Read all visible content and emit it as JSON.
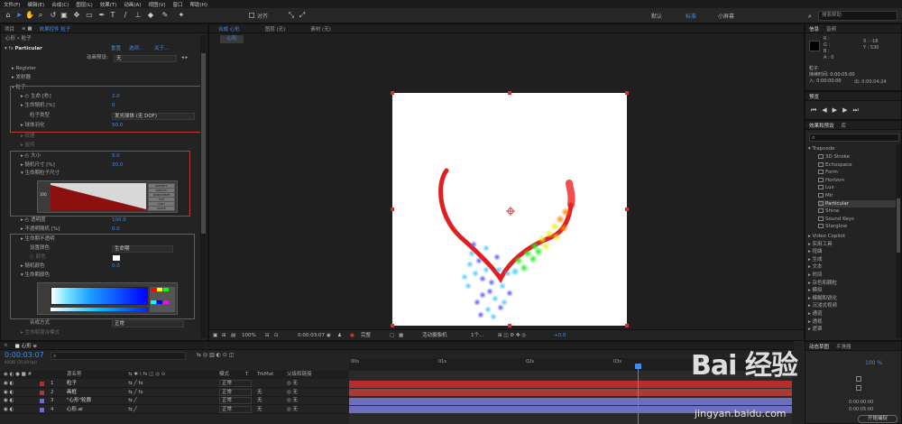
{
  "menu": [
    "文件(F)",
    "编辑(E)",
    "合成(C)",
    "图层(L)",
    "效果(T)",
    "动画(A)",
    "视图(V)",
    "窗口",
    "帮助(H)"
  ],
  "toolbar": {
    "align_label": "对齐",
    "workspaces": [
      "默认",
      "标准",
      "小屏幕"
    ],
    "active_workspace": "标准",
    "search_placeholder": "搜索帮助"
  },
  "project": {
    "tab_project": "项目",
    "tab_effect_controls": "效果控件 粒子",
    "breadcrumb": "心形 • 粒子"
  },
  "effect": {
    "name": "Particular",
    "links": [
      "重置",
      "选项...",
      "关于..."
    ],
    "preset_label": "动画预设:",
    "preset_value": "无",
    "rows": [
      "Register",
      "发射器"
    ],
    "particle_section": "粒子",
    "life": "生命 [秒]",
    "life_val": "2.0",
    "life_rand": "生命随机 [%]",
    "life_rand_val": "0",
    "ptype": "粒子类型",
    "ptype_val": "发光球体 (无 DOF)",
    "sphere": "球体羽化",
    "sphere_val": "50.0",
    "texture": "纹理",
    "rotation": "旋转",
    "size": "大小",
    "size_val": "5.0",
    "size_rand": "随机尺寸 [%]",
    "size_rand_val": "30.0",
    "size_life": "生命期粒子尺寸",
    "graph_label": "100",
    "graph_btns": [
      "PRESETS",
      "SMOOTH",
      "RANDOMIZE",
      "FLIP",
      "COPY",
      "PASTE"
    ],
    "opacity": "透明度",
    "opacity_val": "100.0",
    "opacity_rand": "不透明随机 [%]",
    "opacity_rand_val": "0.0",
    "op_life": "生命期不透明",
    "color_set": "设置颜色",
    "color_set_val": "生命期",
    "color": "颜色",
    "color_rand": "随机颜色",
    "color_rand_val": "0.0",
    "color_life": "生命期颜色",
    "grad_labels": [
      "PRESETS",
      "RANDOMIZE"
    ],
    "blend": "合成方式",
    "blend_val": "正常",
    "trans": "生命期混合模式"
  },
  "viewer": {
    "tabs": [
      "合成 心形",
      "图层 (无)",
      "素材 (无)"
    ],
    "active_tab": "心形",
    "zoom": "100%",
    "timecode": "0:00:03:07",
    "quality": "完整",
    "camera": "活动摄像机",
    "views": "1个...",
    "exposure": "+0.0"
  },
  "info": {
    "tab_info": "信息",
    "tab_audio": "音频",
    "r": "R :",
    "g": "G :",
    "b": "B :",
    "a": "A : 0",
    "x": "X : -18",
    "y": "Y : 530",
    "layer": "粒子",
    "duration": "持续时间: 0:00:05:00",
    "in": "入: 0:00:00:00",
    "out": "出: 0:00:04:24"
  },
  "preview": {
    "tab": "预览"
  },
  "effects_presets": {
    "tab": "效果和预设",
    "tab2": "库",
    "search_placeholder": "",
    "folder": "Trapcode",
    "items": [
      "3D Stroke",
      "Echospace",
      "Form",
      "Horizon",
      "Lux",
      "Mir",
      "Particular",
      "Shine",
      "Sound Keys",
      "Starglow"
    ],
    "selected": "Particular",
    "categories": [
      "Video Copilot",
      "实用工具",
      "扭曲",
      "生成",
      "文本",
      "时间",
      "杂色和颗粒",
      "模拟",
      "模糊和锐化",
      "沉浸式视频",
      "通道",
      "透视",
      "遮罩"
    ]
  },
  "timeline": {
    "tab": "心形",
    "timecode": "0:00:03:07",
    "frames": "00082 (25.00 fps)",
    "col_headers": [
      "源名称",
      "模式",
      "T",
      "TrkMat",
      "父级和链接"
    ],
    "ruler": [
      "00s",
      "01s",
      "02s",
      "03s",
      "04s"
    ],
    "layers": [
      {
        "num": "1",
        "name": "粒子",
        "mode": "正常",
        "trk": "",
        "parent": "无",
        "color": "#b72d2d"
      },
      {
        "num": "2",
        "name": "画框",
        "mode": "正常",
        "trk": "无",
        "parent": "无",
        "color": "#a83a3a"
      },
      {
        "num": "3",
        "name": "\"心形\"轮廓",
        "mode": "正常",
        "trk": "无",
        "parent": "无",
        "color": "#6b6fbd"
      },
      {
        "num": "4",
        "name": "心形.ai",
        "mode": "正常",
        "trk": "无",
        "parent": "无",
        "color": "#6b6fbd"
      }
    ]
  },
  "right_bottom": {
    "tab1": "动态草图",
    "tab2": "平滑器",
    "pct": "100 %",
    "watermark": "Bai 经验",
    "url": "jingyan.baidu.com",
    "dur_a": "0:00:00:00",
    "dur_b": "0:00:05:00",
    "start": "开始捕捉"
  },
  "colors": {
    "accent": "#3d8cf0",
    "particle_red": "#e02020",
    "highlight_box": "#c0392b"
  }
}
